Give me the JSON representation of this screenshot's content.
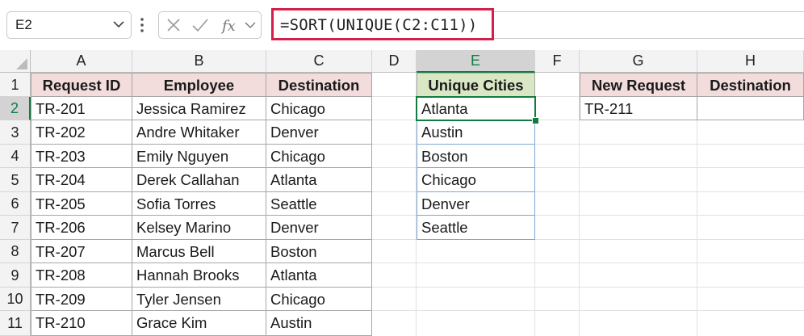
{
  "formula_bar": {
    "name_box": "E2",
    "formula": "=SORT(UNIQUE(C2:C11))"
  },
  "columns": [
    "A",
    "B",
    "C",
    "D",
    "E",
    "F",
    "G",
    "H"
  ],
  "rows": [
    "1",
    "2",
    "3",
    "4",
    "5",
    "6",
    "7",
    "8",
    "9",
    "10",
    "11"
  ],
  "table1": {
    "headers": [
      "Request ID",
      "Employee",
      "Destination"
    ],
    "rows": [
      [
        "TR-201",
        "Jessica Ramirez",
        "Chicago"
      ],
      [
        "TR-202",
        "Andre Whitaker",
        "Denver"
      ],
      [
        "TR-203",
        "Emily Nguyen",
        "Chicago"
      ],
      [
        "TR-204",
        "Derek Callahan",
        "Atlanta"
      ],
      [
        "TR-205",
        "Sofia Torres",
        "Seattle"
      ],
      [
        "TR-206",
        "Kelsey Marino",
        "Denver"
      ],
      [
        "TR-207",
        "Marcus Bell",
        "Boston"
      ],
      [
        "TR-208",
        "Hannah Brooks",
        "Atlanta"
      ],
      [
        "TR-209",
        "Tyler Jensen",
        "Chicago"
      ],
      [
        "TR-210",
        "Grace Kim",
        "Austin"
      ]
    ]
  },
  "unique": {
    "header": "Unique Cities",
    "values": [
      "Atlanta",
      "Austin",
      "Boston",
      "Chicago",
      "Denver",
      "Seattle"
    ]
  },
  "new_request": {
    "headers": [
      "New Request",
      "Destination"
    ],
    "row": [
      "TR-211",
      ""
    ]
  },
  "colors": {
    "accent_green": "#107c41",
    "header_pink": "#f2dcdc",
    "header_green": "#d9e7c5",
    "formula_highlight": "#d41f4a"
  },
  "icons": {
    "cancel": "close-icon",
    "enter": "checkmark-icon",
    "function": "fx-icon",
    "dropdown": "chevron-down-icon"
  }
}
